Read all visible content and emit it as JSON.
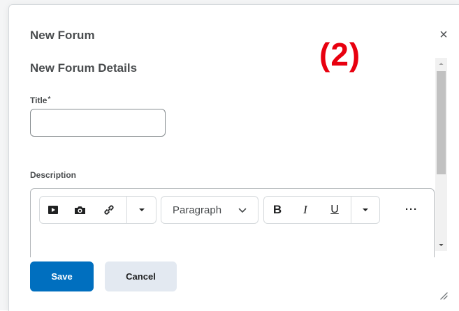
{
  "dialog": {
    "title": "New Forum",
    "close_glyph": "×",
    "annotation": "(2)"
  },
  "form": {
    "section_title": "New Forum Details",
    "title_label": "Title",
    "required_mark": "*",
    "title_value": "",
    "description_label": "Description"
  },
  "toolbar": {
    "icons": [
      "video-icon",
      "camera-icon",
      "link-icon",
      "chevron-down-icon"
    ],
    "format_value": "Paragraph",
    "bold_label": "B",
    "italic_label": "I",
    "underline_label": "U",
    "more_label": "···"
  },
  "buttons": {
    "save": "Save",
    "cancel": "Cancel"
  },
  "colors": {
    "primary": "#006fbf",
    "secondary": "#e3e9f1",
    "annotation": "#e8000f"
  }
}
